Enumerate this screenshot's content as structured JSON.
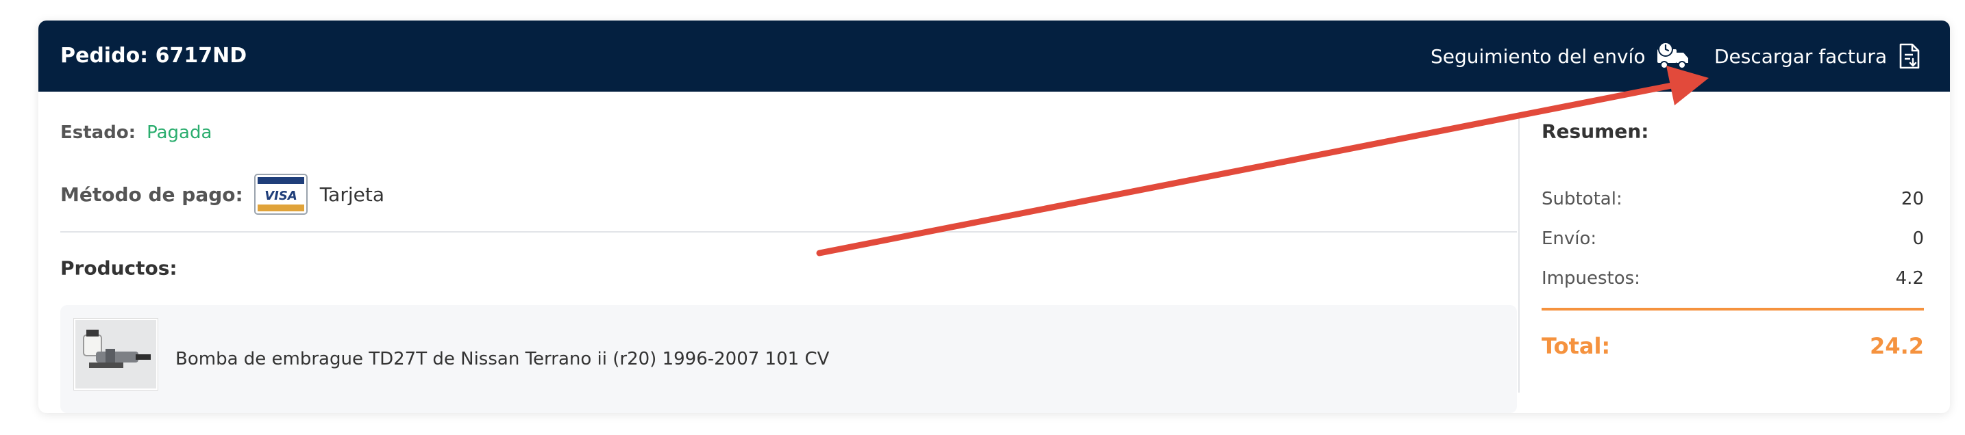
{
  "header": {
    "order_label": "Pedido: 6717ND",
    "tracking_label": "Seguimiento del envío",
    "tracking_icon": "truck-clock-icon",
    "invoice_label": "Descargar factura",
    "invoice_icon": "document-download-icon"
  },
  "details": {
    "status_label": "Estado:",
    "status_value": "Pagada",
    "payment_label": "Método de pago:",
    "payment_card_brand": "VISA",
    "payment_value": "Tarjeta"
  },
  "products": {
    "title": "Productos:",
    "items": [
      {
        "name": "Bomba de embrague TD27T de Nissan Terrano ii (r20) 1996-2007 101 CV"
      }
    ]
  },
  "summary": {
    "title": "Resumen:",
    "subtotal_label": "Subtotal:",
    "subtotal_value": "20",
    "shipping_label": "Envío:",
    "shipping_value": "0",
    "taxes_label": "Impuestos:",
    "taxes_value": "4.2",
    "total_label": "Total:",
    "total_value": "24.2"
  },
  "colors": {
    "header_bg": "#042040",
    "status_paid": "#2aad6e",
    "total_accent": "#f5923e",
    "annotation_arrow": "#e24a3b"
  }
}
